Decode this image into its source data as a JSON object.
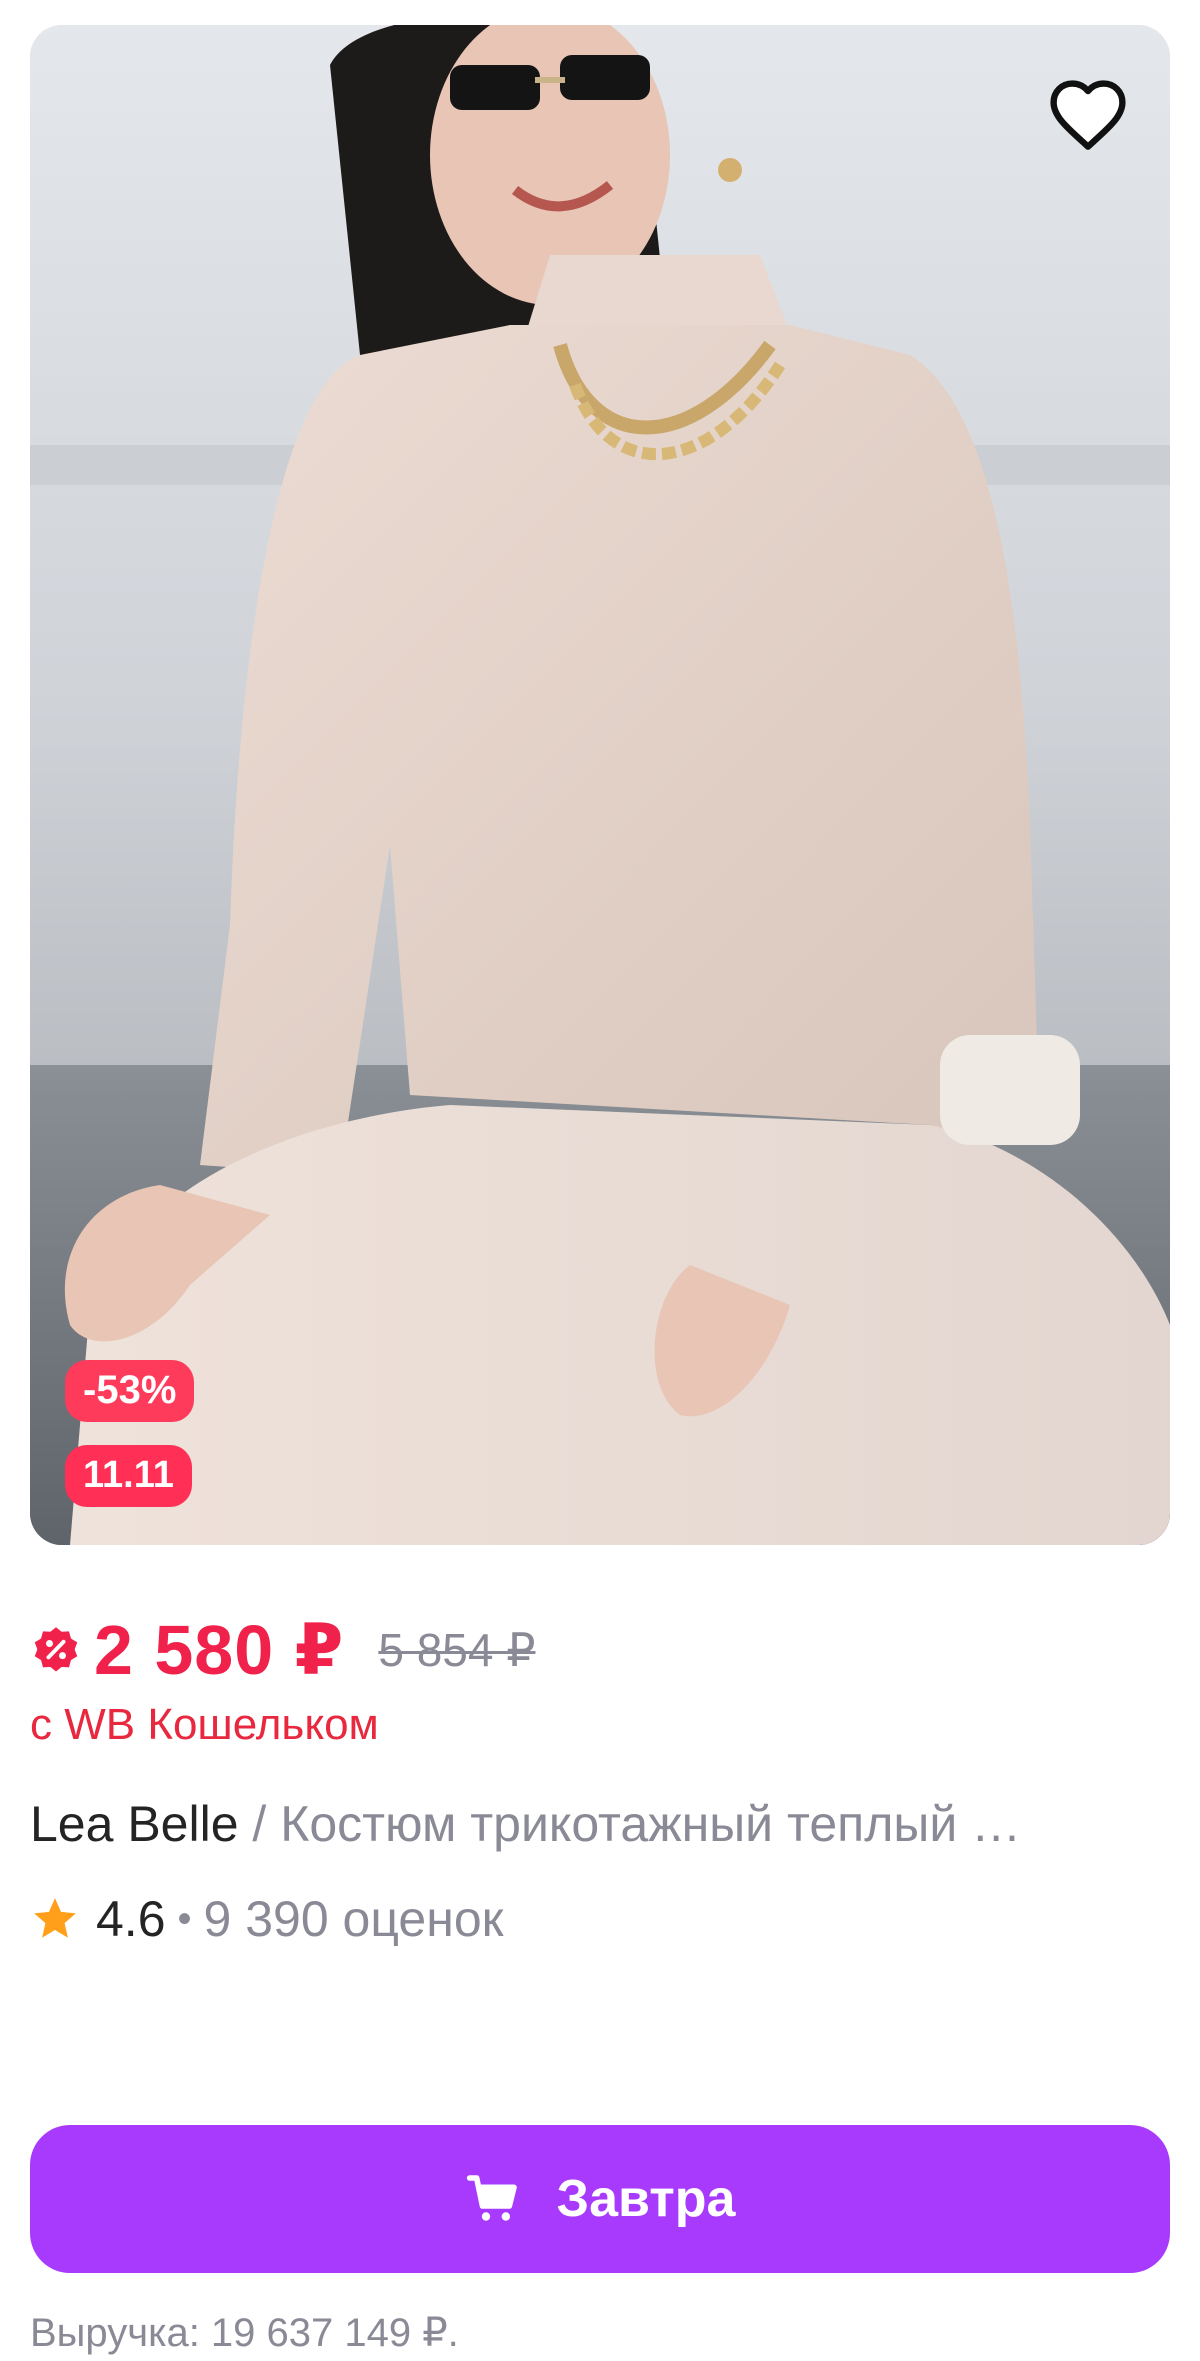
{
  "product": {
    "image_alt": "woman in light beige knit tracksuit",
    "favorite_icon": "heart-outline-icon",
    "badges": {
      "discount": "-53%",
      "promo": "11.11"
    },
    "price": {
      "current": "2 580 ₽",
      "old": "5 854 ₽",
      "wallet_note": "с WB Кошельком",
      "icon": "discount-badge-icon",
      "accent_color": "#f0214a"
    },
    "brand": "Lea Belle",
    "separator": "/",
    "name": "Костюм трикотажный теплый …",
    "rating": {
      "star_icon": "star-icon",
      "value": "4.6",
      "dot": "•",
      "count": "9 390 оценок"
    },
    "delivery_button": {
      "icon": "cart-icon",
      "label": "Завтра",
      "color": "#a73afd"
    },
    "revenue": "Выручка: 19 637 149 ₽."
  }
}
